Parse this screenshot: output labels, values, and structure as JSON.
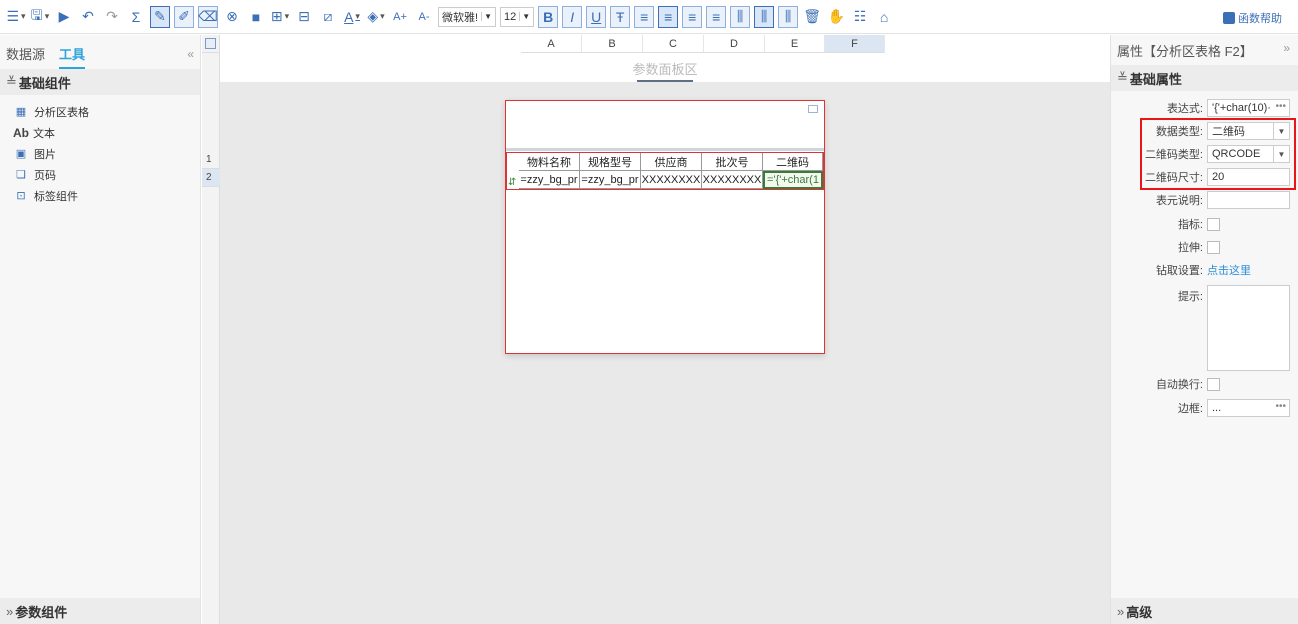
{
  "toolbar": {
    "font_family": "微软雅!",
    "font_size": "12",
    "help_label": "函数帮助",
    "icons": [
      "menu-icon",
      "save-icon",
      "preview-icon",
      "undo-icon",
      "redo-icon",
      "sum-icon",
      "format-brush-icon",
      "edit-icon",
      "clear-icon",
      "delete-icon",
      "fill-icon",
      "merge-icon",
      "insert-icon",
      "slash-icon",
      "font-color-icon",
      "bg-color-icon",
      "font-increase-icon",
      "font-decrease-icon",
      "bold-icon",
      "italic-icon",
      "underline-icon",
      "strikethrough-icon",
      "align-left-icon",
      "align-center-icon",
      "align-right-icon",
      "justify-icon",
      "valign-top-icon",
      "valign-middle-icon",
      "valign-bottom-icon",
      "trash-icon",
      "hand-icon",
      "list-icon",
      "lock-icon"
    ]
  },
  "left_panel": {
    "tabs": [
      "数据源",
      "工具"
    ],
    "active_tab": "工具",
    "section_basic": "基础组件",
    "items": [
      {
        "icon": "table-icon",
        "label": "分析区表格"
      },
      {
        "icon": "text-icon",
        "label": "文本",
        "prefix": "Ab"
      },
      {
        "icon": "image-icon",
        "label": "图片"
      },
      {
        "icon": "page-number-icon",
        "label": "页码"
      },
      {
        "icon": "label-icon",
        "label": "标签组件"
      }
    ],
    "section_params": "参数组件"
  },
  "grid": {
    "columns": [
      "A",
      "B",
      "C",
      "D",
      "E",
      "F"
    ],
    "selected_column": "F",
    "rows": [
      "1",
      "2"
    ],
    "selected_row": "2",
    "param_area_label": "参数面板区"
  },
  "table": {
    "headers": [
      "物料名称",
      "规格型号",
      "供应商",
      "批次号",
      "二维码"
    ],
    "row": [
      "=zzy_bg_pr",
      "=zzy_bg_pr",
      "XXXXXXXX",
      "XXXXXXXX",
      "='{'+char(1"
    ]
  },
  "right_panel": {
    "title": "属性【分析区表格 F2】",
    "section_basic": "基础属性",
    "props": {
      "expression_label": "表达式:",
      "expression_value": "'{'+char(10)·",
      "data_type_label": "数据类型:",
      "data_type_value": "二维码",
      "qr_type_label": "二维码类型:",
      "qr_type_value": "QRCODE",
      "qr_size_label": "二维码尺寸:",
      "qr_size_value": "20",
      "description_label": "表元说明:",
      "indicator_label": "指标:",
      "stretch_label": "拉伸:",
      "drill_label": "钻取设置:",
      "drill_link": "点击这里",
      "hint_label": "提示:",
      "auto_wrap_label": "自动换行:",
      "border_label": "边框:",
      "border_value": "..."
    },
    "section_advanced": "高级"
  },
  "colors": {
    "accent": "#2ea4d8",
    "highlight": "#e8151b",
    "toolbar_icon": "#3b6fb6"
  }
}
